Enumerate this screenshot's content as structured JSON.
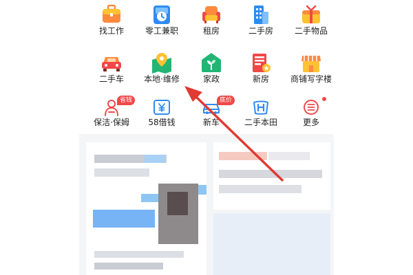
{
  "grid": {
    "row1": [
      {
        "label": "找工作",
        "icon": "briefcase-icon"
      },
      {
        "label": "零工兼职",
        "icon": "clock-icon"
      },
      {
        "label": "租房",
        "icon": "armchair-icon"
      },
      {
        "label": "二手房",
        "icon": "building-icon"
      },
      {
        "label": "二手物品",
        "icon": "gift-box-icon"
      }
    ],
    "row2": [
      {
        "label": "二手车",
        "icon": "car-icon"
      },
      {
        "label": "本地·维修",
        "icon": "map-pin-icon"
      },
      {
        "label": "家政",
        "icon": "house-sprout-icon"
      },
      {
        "label": "新房",
        "icon": "new-house-icon"
      },
      {
        "label": "商铺写字楼",
        "icon": "storefront-icon"
      }
    ],
    "row3": [
      {
        "label": "保洁·保姆",
        "icon": "cleaner-icon",
        "badge": "省钱"
      },
      {
        "label": "58借钱",
        "icon": "yuan-wallet-icon"
      },
      {
        "label": "新车",
        "icon": "new-car-icon",
        "badge": "底价"
      },
      {
        "label": "二手本田",
        "icon": "honda-logo-icon"
      },
      {
        "label": "更多",
        "icon": "more-menu-icon"
      }
    ]
  },
  "colors": {
    "red": "#f04848",
    "orange": "#ff8a3d",
    "yellow": "#ffc233",
    "blue": "#2d8cf0",
    "green": "#22b573",
    "arrow": "#e03a34"
  }
}
